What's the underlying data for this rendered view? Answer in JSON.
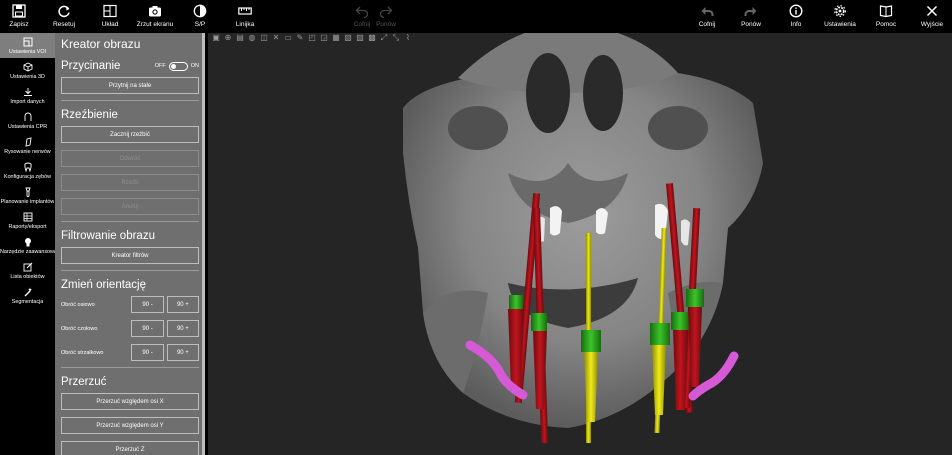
{
  "toolbar": {
    "left": [
      {
        "label": "Zapisz",
        "icon": "save-icon"
      },
      {
        "label": "Resetuj",
        "icon": "refresh-icon"
      },
      {
        "label": "Układ",
        "icon": "layout-icon"
      },
      {
        "label": "Zrzut ekranu",
        "icon": "camera-icon"
      },
      {
        "label": "S/P",
        "icon": "contrast-icon"
      },
      {
        "label": "Linijka",
        "icon": "ruler-icon"
      }
    ],
    "center": [
      {
        "label": "Cofnij",
        "icon": "undo-icon"
      },
      {
        "label": "Ponów",
        "icon": "redo-icon"
      }
    ],
    "right": [
      {
        "label": "Cofnij",
        "icon": "undo-icon"
      },
      {
        "label": "Ponów",
        "icon": "redo-icon"
      },
      {
        "label": "Info",
        "icon": "info-icon"
      },
      {
        "label": "Ustawienia",
        "icon": "gear-icon"
      },
      {
        "label": "Pomoc",
        "icon": "book-icon"
      },
      {
        "label": "Wyjście",
        "icon": "close-icon"
      }
    ]
  },
  "nav": [
    {
      "label": "Ustawienia VOI",
      "icon": "cube-icon",
      "active": true
    },
    {
      "label": "Ustawienia 3D",
      "icon": "cube-3d-icon"
    },
    {
      "label": "Import danych",
      "icon": "download-icon"
    },
    {
      "label": "Ustawienia CPR",
      "icon": "arch-icon"
    },
    {
      "label": "Rysowanie nerwów",
      "icon": "nerve-icon"
    },
    {
      "label": "Konfiguracja zębów",
      "icon": "tooth-icon"
    },
    {
      "label": "Planowanie implantów",
      "icon": "implant-icon"
    },
    {
      "label": "Raporty/eksport",
      "icon": "report-icon"
    },
    {
      "label": "Narzędzie zaawansowane",
      "icon": "advanced-tool-icon"
    },
    {
      "label": "Lista obiektów",
      "icon": "list-edit-icon"
    },
    {
      "label": "Segmentacja",
      "icon": "wand-icon"
    }
  ],
  "panel": {
    "title": "Kreator obrazu",
    "crop": {
      "title": "Przycinanie",
      "toggle_off": "OFF",
      "toggle_on": "ON",
      "button": "Przytnij na stałe"
    },
    "sculpt": {
      "title": "Rzeźbienie",
      "buttons": [
        "Zacznij rzeźbić",
        "Odwróć",
        "Rzeźb",
        "Anuluj"
      ]
    },
    "filter": {
      "title": "Filtrowanie obrazu",
      "button": "Kreator filtrów"
    },
    "orient": {
      "title": "Zmień orientację",
      "rows": [
        {
          "label": "Obróć osiowo",
          "minus": "90 -",
          "plus": "90 +"
        },
        {
          "label": "Obróć czołowo",
          "minus": "90 -",
          "plus": "90 +"
        },
        {
          "label": "Obróć strzałkowo",
          "minus": "90 -",
          "plus": "90 +"
        }
      ]
    },
    "flip": {
      "title": "Przerzuć",
      "buttons": [
        "Przerzuć względem osi X",
        "Przerzuć względem osi Y",
        "Przerzuć Z"
      ]
    }
  },
  "colors": {
    "implant_red": "#b3121b",
    "implant_yellow": "#e4e00b",
    "abutment_green": "#2fae1f",
    "nerve_pink": "#d65ad6",
    "panel_bg": "#6f6f6f"
  }
}
